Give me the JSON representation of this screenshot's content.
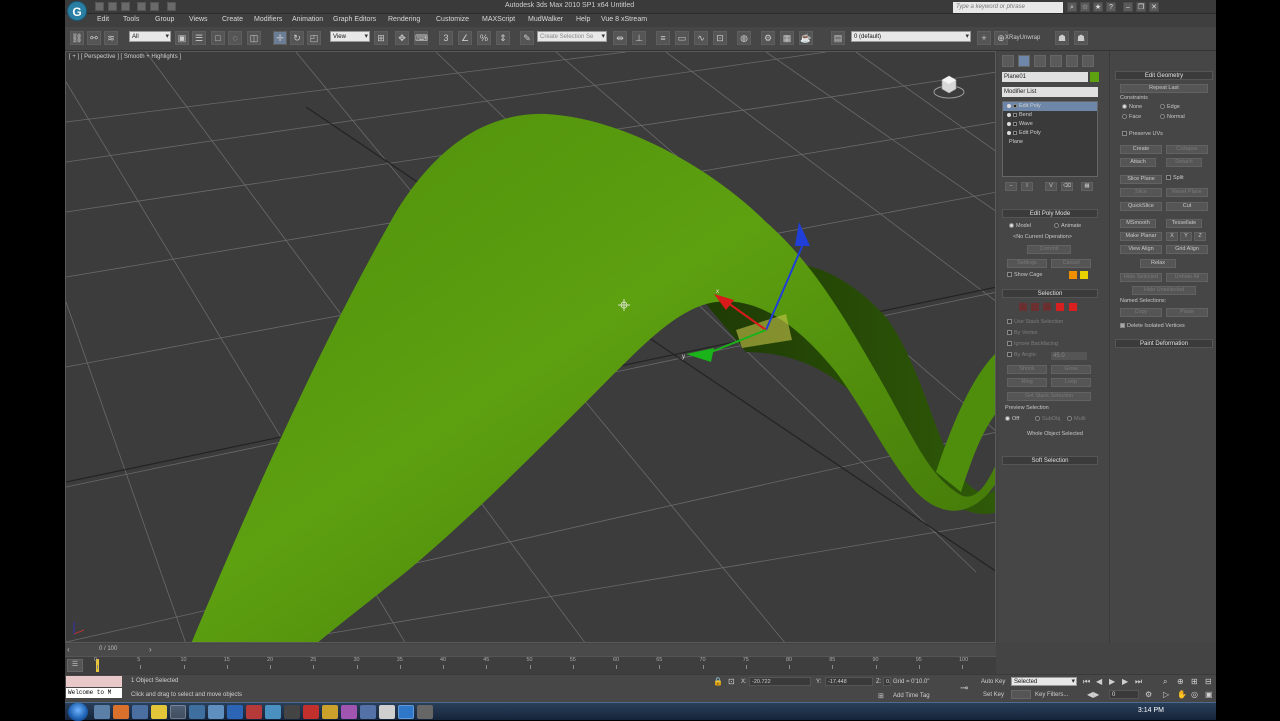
{
  "titlebar": {
    "title": "Autodesk 3ds Max 2010 SP1 x64      Untitled",
    "search_placeholder": "Type a keyword or phrase"
  },
  "logo": {
    "letter": "G"
  },
  "menus": [
    "Edit",
    "Tools",
    "Group",
    "Views",
    "Create",
    "Modifiers",
    "Animation",
    "Graph Editors",
    "Rendering",
    "Customize",
    "MAXScript",
    "MudWalker",
    "Help",
    "Vue 8 xStream"
  ],
  "toolbar": {
    "filter_value": "All",
    "refcoord_value": "View",
    "selection_set_placeholder": "Create Selection Se",
    "layer_value": "0 (default)",
    "raybutton_label": "XRayUnwrap"
  },
  "viewport": {
    "label": "[ + ] [ Perspective ] [ Smooth + Highlights ]",
    "axis_x": "x",
    "axis_y": "y"
  },
  "command_panel": {
    "object_name": "Plane01",
    "modifier_list": "Modifier List",
    "stack": [
      {
        "label": "Edit Poly",
        "selected": true
      },
      {
        "label": "Bend",
        "selected": false
      },
      {
        "label": "Wave",
        "selected": false
      },
      {
        "label": "Edit Poly",
        "selected": false
      },
      {
        "label": "Plane",
        "selected": false
      }
    ],
    "edit_poly_mode": {
      "header": "Edit Poly Mode",
      "model": "Model",
      "animate": "Animate",
      "current_op": "<No Current Operation>",
      "commit": "Commit",
      "settings": "Settings",
      "cancel": "Cancel",
      "show_cage": "Show Cage"
    },
    "selection": {
      "header": "Selection",
      "use_stack": "Use Stack Selection",
      "by_vertex": "By Vertex",
      "ignore_backfacing": "Ignore Backfacing",
      "by_angle": "By Angle:",
      "angle_value": "45.0",
      "shrink": "Shrink",
      "grow": "Grow",
      "ring": "Ring",
      "loop": "Loop",
      "get_stack": "Get Stack Selection",
      "preview": "Preview Selection",
      "off": "Off",
      "subobj": "SubObj",
      "multi": "Multi",
      "whole_object": "Whole Object Selected"
    },
    "soft_selection": "Soft Selection"
  },
  "edit_geometry": {
    "header": "Edit Geometry",
    "repeat_last": "Repeat Last",
    "constraints": "Constraints",
    "none": "None",
    "edge": "Edge",
    "face": "Face",
    "normal": "Normal",
    "preserve_uvs": "Preserve UVs",
    "create": "Create",
    "collapse": "Collapse",
    "attach": "Attach",
    "detach": "Detach",
    "slice_plane": "Slice Plane",
    "split": "Split",
    "slice": "Slice",
    "reset_plane": "Reset Plane",
    "quickslice": "QuickSlice",
    "cut": "Cut",
    "msmooth": "MSmooth",
    "tessellate": "Tessellate",
    "make_planar": "Make Planar",
    "x": "X",
    "y": "Y",
    "z": "Z",
    "view_align": "View Align",
    "grid_align": "Grid Align",
    "relax": "Relax",
    "hide_selected": "Hide Selected",
    "unhide_all": "Unhide All",
    "hide_unselected": "Hide Unselected",
    "named_selections": "Named Selections:",
    "copy": "Copy",
    "paste": "Paste",
    "delete_isolated": "Delete Isolated Vertices",
    "paint_deformation": "Paint Deformation"
  },
  "timeline": {
    "frame_label": "0 / 100",
    "ticks": [
      "0",
      "5",
      "10",
      "15",
      "20",
      "25",
      "30",
      "35",
      "40",
      "45",
      "50",
      "55",
      "60",
      "65",
      "70",
      "75",
      "80",
      "85",
      "90",
      "95",
      "100"
    ]
  },
  "status": {
    "listener_text": "Welcome to M",
    "selected_count": "1 Object Selected",
    "prompt": "Click and drag to select and move objects",
    "x_label": "X:",
    "x_value": "-20.722",
    "y_label": "Y:",
    "y_value": "-17.448",
    "z_label": "Z:",
    "z_value": "0.0",
    "grid": "Grid = 0'10.0\"",
    "add_time_tag": "Add Time Tag",
    "auto_key": "Auto Key",
    "set_key": "Set Key",
    "selected_dd": "Selected",
    "key_filters": "Key Filters...",
    "frame_value": "0"
  },
  "taskbar": {
    "clock": "3:14 PM"
  },
  "colors": {
    "mesh": "#5da010",
    "accent": "#6e87a8",
    "gizmo_z": "#1f3fd8",
    "gizmo_x": "#d81a1a",
    "gizmo_y": "#1ab31a"
  }
}
